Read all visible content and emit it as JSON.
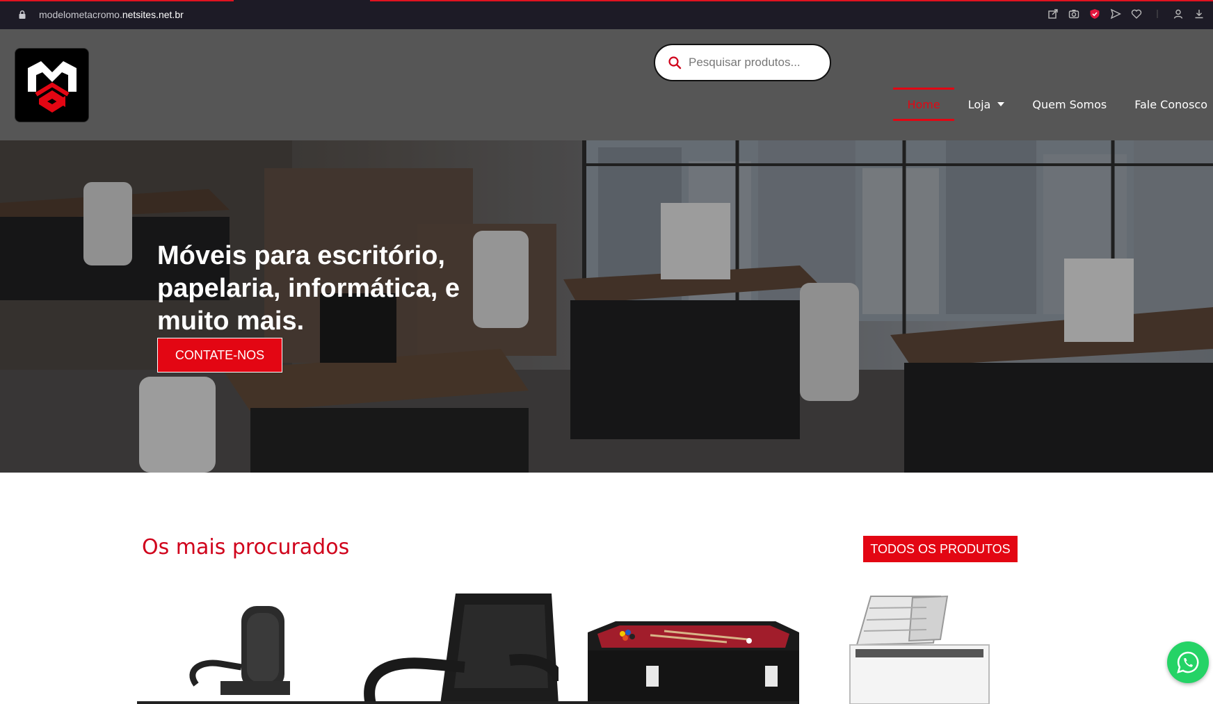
{
  "browser": {
    "url_prefix": "modelometacromo.",
    "url_domain": "netsites.net.br",
    "icons": [
      "share-icon",
      "camera-icon",
      "shield-icon",
      "send-icon",
      "heart-icon",
      "profile-icon",
      "download-icon"
    ]
  },
  "header": {
    "logo_alt": "MC",
    "search_placeholder": "Pesquisar produtos...",
    "nav": [
      {
        "label": "Home",
        "active": true
      },
      {
        "label": "Loja",
        "has_dropdown": true
      },
      {
        "label": "Quem Somos"
      },
      {
        "label": "Fale Conosco"
      }
    ]
  },
  "hero": {
    "title": "Móveis para escritório, papelaria, informática, e muito mais.",
    "button": "CONTATE-NOS"
  },
  "products_section": {
    "title": "Os mais procurados",
    "all_button": "TODOS OS PRODUTOS",
    "items": [
      {
        "name": "office-chair-high-back"
      },
      {
        "name": "leather-executive-chair"
      },
      {
        "name": "pool-table"
      },
      {
        "name": "chest-freezer"
      }
    ]
  },
  "colors": {
    "accent": "#e30613",
    "header_bg": "#565656",
    "browser_bg": "#1d1b26",
    "whatsapp": "#25d366"
  }
}
